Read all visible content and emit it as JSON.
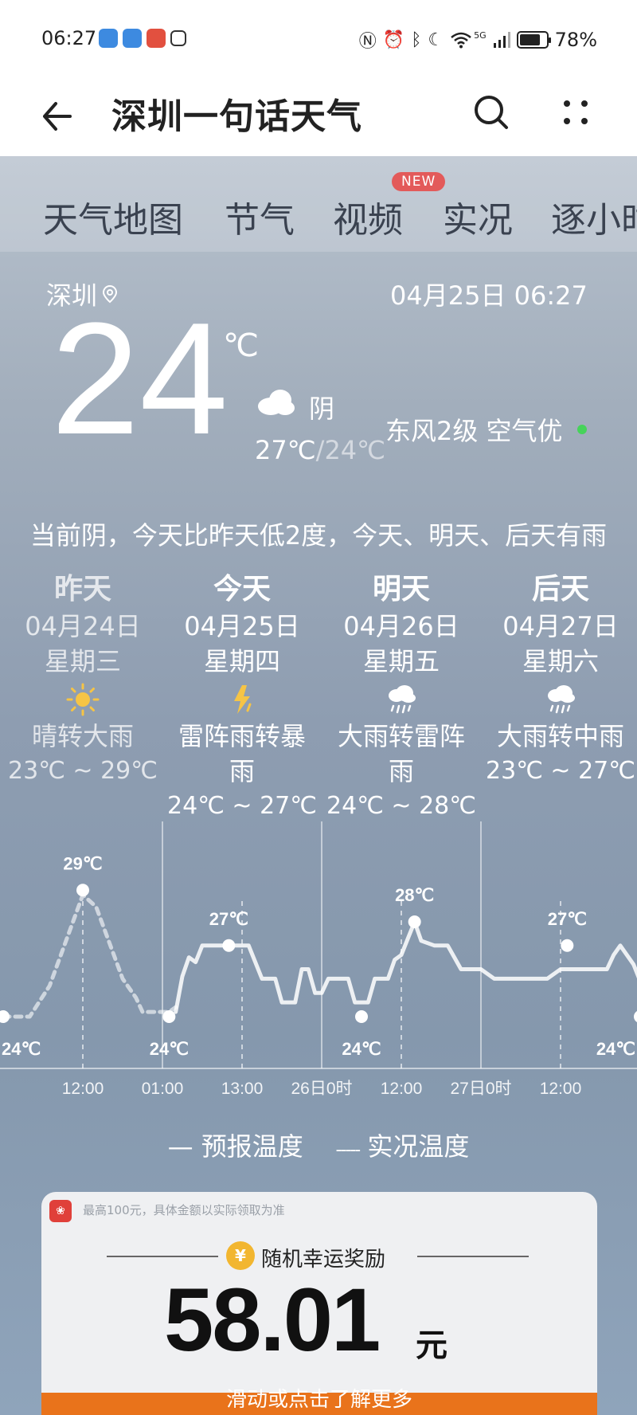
{
  "status_bar": {
    "time": "06:27",
    "network": "5G",
    "battery": "78%",
    "battery_level": 0.78
  },
  "header": {
    "title": "深圳一句话天气"
  },
  "tabs": [
    {
      "label": "天气地图"
    },
    {
      "label": "节气"
    },
    {
      "label": "视频",
      "badge": "NEW"
    },
    {
      "label": "实况"
    },
    {
      "label": "逐小时"
    }
  ],
  "current": {
    "city": "深圳",
    "datetime": "04月25日 06:27",
    "temp": "24",
    "unit": "℃",
    "condition": "阴",
    "high": "27℃",
    "low": "24℃",
    "wind_air": "东风2级 空气优",
    "aqi_color": "#46d35a",
    "summary": "当前阴，今天比昨天低2度，今天、明天、后天有雨"
  },
  "days": [
    {
      "name": "昨天",
      "date": "04月24日",
      "weekday": "星期三",
      "icon": "sun-icon",
      "desc": "晴转大雨",
      "range": "23℃ ~ 29℃"
    },
    {
      "name": "今天",
      "date": "04月25日",
      "weekday": "星期四",
      "icon": "thunder-icon",
      "desc": "雷阵雨转暴雨",
      "range": "24℃ ~ 27℃"
    },
    {
      "name": "明天",
      "date": "04月26日",
      "weekday": "星期五",
      "icon": "heavy-rain-icon",
      "desc": "大雨转雷阵雨",
      "range": "24℃ ~ 28℃"
    },
    {
      "name": "后天",
      "date": "04月27日",
      "weekday": "星期六",
      "icon": "heavy-rain-icon",
      "desc": "大雨转中雨",
      "range": "23℃ ~ 27℃"
    }
  ],
  "chart_data": {
    "type": "line",
    "x_ticks": [
      "12:00",
      "01:00",
      "13:00",
      "26日0时",
      "12:00",
      "27日0时",
      "12:00"
    ],
    "point_labels": [
      {
        "text": "24℃",
        "value": 24,
        "hour": -24
      },
      {
        "text": "29℃",
        "value": 29,
        "hour": -12
      },
      {
        "text": "24℃",
        "value": 24,
        "hour": 1
      },
      {
        "text": "27℃",
        "value": 27,
        "hour": 10
      },
      {
        "text": "24℃",
        "value": 24,
        "hour": 30
      },
      {
        "text": "28℃",
        "value": 28,
        "hour": 38
      },
      {
        "text": "27℃",
        "value": 27,
        "hour": 61
      },
      {
        "text": "24℃",
        "value": 24,
        "hour": 72
      }
    ],
    "series": [
      {
        "name": "实况温度",
        "style": "dashed",
        "points": [
          [
            -24,
            24
          ],
          [
            -20,
            24
          ],
          [
            -17,
            25.3
          ],
          [
            -12,
            28.8
          ],
          [
            -10,
            28.3
          ],
          [
            -6,
            25.6
          ],
          [
            -4,
            24.8
          ],
          [
            -3,
            24.2
          ],
          [
            1,
            24.2
          ],
          [
            2,
            24.4
          ]
        ]
      },
      {
        "name": "预报温度",
        "style": "solid",
        "points": [
          [
            2,
            24.2
          ],
          [
            3,
            25.7
          ],
          [
            4,
            26.5
          ],
          [
            5,
            26.3
          ],
          [
            6,
            27
          ],
          [
            13,
            27
          ],
          [
            15,
            25.6
          ],
          [
            17,
            25.6
          ],
          [
            18,
            24.6
          ],
          [
            20,
            24.6
          ],
          [
            21,
            26
          ],
          [
            22,
            26
          ],
          [
            23,
            25
          ],
          [
            24,
            25
          ],
          [
            25,
            25.6
          ],
          [
            28,
            25.6
          ],
          [
            29,
            24.6
          ],
          [
            31,
            24.6
          ],
          [
            32,
            25.6
          ],
          [
            34,
            25.6
          ],
          [
            35,
            26.4
          ],
          [
            36,
            26.6
          ],
          [
            37,
            27.3
          ],
          [
            38,
            28
          ],
          [
            39,
            27.2
          ],
          [
            41,
            27
          ],
          [
            43,
            27
          ],
          [
            45,
            26
          ],
          [
            48,
            26
          ],
          [
            50,
            25.6
          ],
          [
            58,
            25.6
          ],
          [
            60,
            26
          ],
          [
            65,
            26
          ],
          [
            67,
            26
          ],
          [
            68,
            26.6
          ],
          [
            69,
            27
          ],
          [
            71,
            26.2
          ],
          [
            72,
            25.5
          ],
          [
            73,
            24.8
          ],
          [
            74,
            24
          ]
        ]
      }
    ],
    "legend": {
      "solid": "预报温度",
      "dashed": "实况温度"
    }
  },
  "promo": {
    "note": "最高100元，具体金额以实际领取为准",
    "title": "随机幸运奖励",
    "amount": "58.01",
    "unit": "元",
    "hint": "滑动或点击了解更多",
    "coin": "¥"
  }
}
